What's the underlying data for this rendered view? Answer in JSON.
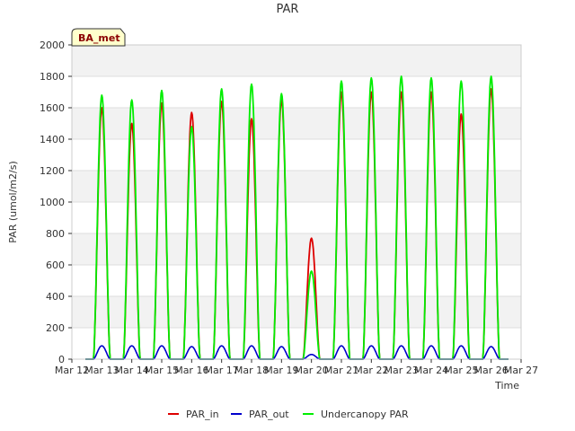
{
  "chart_data": {
    "type": "line",
    "title": "PAR",
    "xlabel": "Time",
    "ylabel": "PAR (umol/m2/s)",
    "badge": "BA_met",
    "x_ticks": [
      "Mar 12",
      "Mar 13",
      "Mar 14",
      "Mar 15",
      "Mar 16",
      "Mar 17",
      "Mar 18",
      "Mar 19",
      "Mar 20",
      "Mar 21",
      "Mar 22",
      "Mar 23",
      "Mar 24",
      "Mar 25",
      "Mar 26",
      "Mar 27"
    ],
    "y_ticks": [
      "0",
      "200",
      "400",
      "600",
      "800",
      "1000",
      "1200",
      "1400",
      "1600",
      "1800",
      "2000"
    ],
    "xlim": [
      12,
      27
    ],
    "ylim": [
      0,
      2000
    ],
    "grid": true,
    "legend_position": "bottom",
    "days": [
      13,
      14,
      15,
      16,
      17,
      18,
      19,
      20,
      21,
      22,
      23,
      24,
      25,
      26
    ],
    "series": [
      {
        "name": "PAR_in",
        "color": "#dd0000",
        "peaks": [
          1600,
          1500,
          1630,
          1570,
          1640,
          1530,
          1650,
          770,
          1700,
          1700,
          1700,
          1700,
          1560,
          1720
        ]
      },
      {
        "name": "PAR_out",
        "color": "#0000cc",
        "peaks": [
          85,
          85,
          85,
          80,
          85,
          85,
          80,
          30,
          85,
          85,
          85,
          85,
          85,
          80
        ]
      },
      {
        "name": "Undercanopy PAR",
        "color": "#00ee00",
        "peaks": [
          1680,
          1650,
          1710,
          1480,
          1720,
          1750,
          1690,
          560,
          1770,
          1790,
          1800,
          1790,
          1770,
          1800
        ]
      }
    ]
  }
}
